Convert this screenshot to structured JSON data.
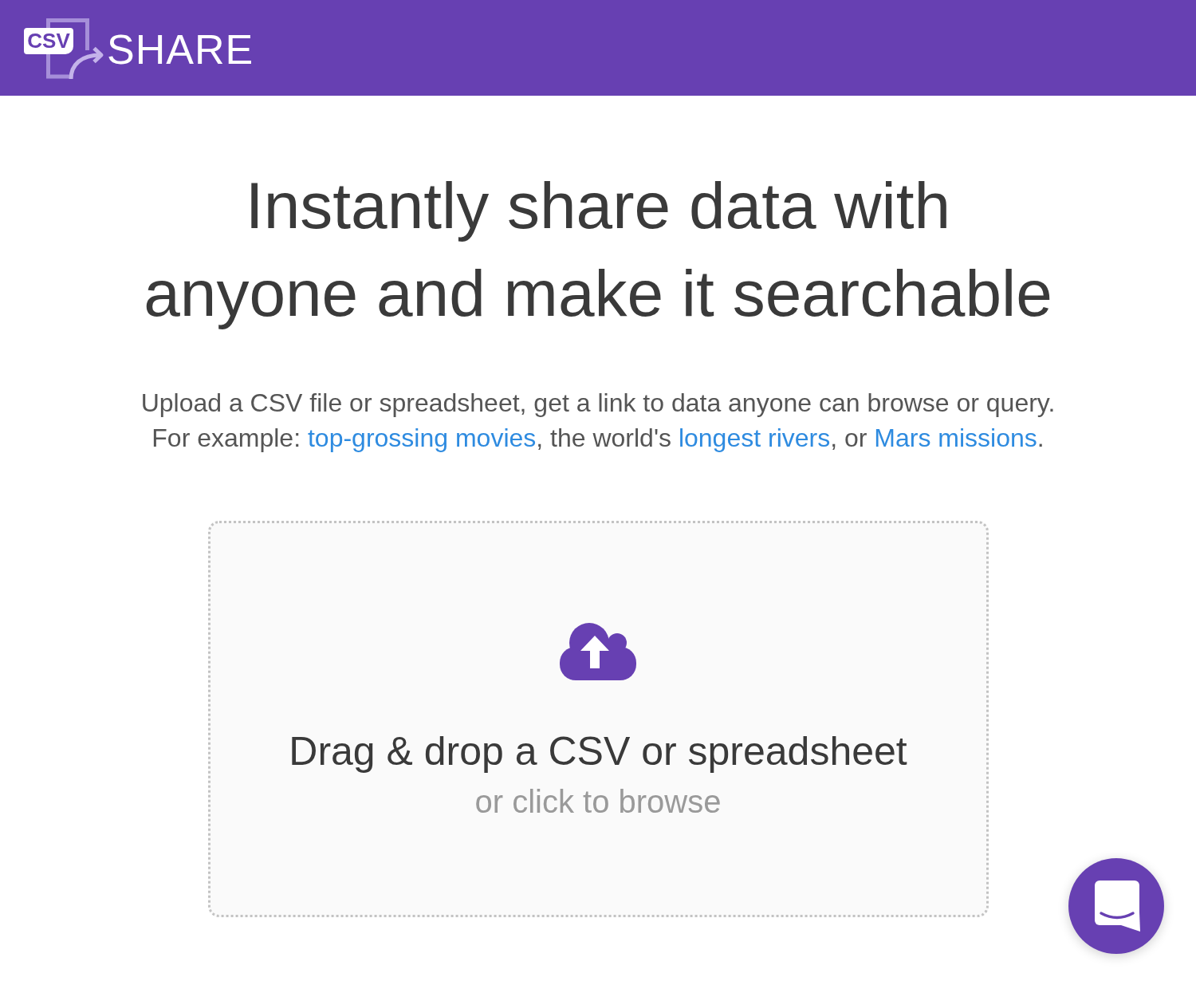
{
  "header": {
    "logo": {
      "badge": "CSV",
      "wordmark": "SHARE"
    }
  },
  "hero": {
    "title": "Instantly share data with anyone and make it searchable",
    "intro": "Upload a CSV file or spreadsheet, get a link to data anyone can browse or query.",
    "examples": [
      {
        "kind": "text",
        "text": "For example: "
      },
      {
        "kind": "link",
        "text": "top-grossing movies"
      },
      {
        "kind": "text",
        "text": ", the world's "
      },
      {
        "kind": "link",
        "text": "longest rivers"
      },
      {
        "kind": "text",
        "text": ", or "
      },
      {
        "kind": "link",
        "text": "Mars missions"
      },
      {
        "kind": "text",
        "text": "."
      }
    ]
  },
  "dropzone": {
    "title": "Drag & drop a CSV or spreadsheet",
    "hint": "or click to browse"
  }
}
